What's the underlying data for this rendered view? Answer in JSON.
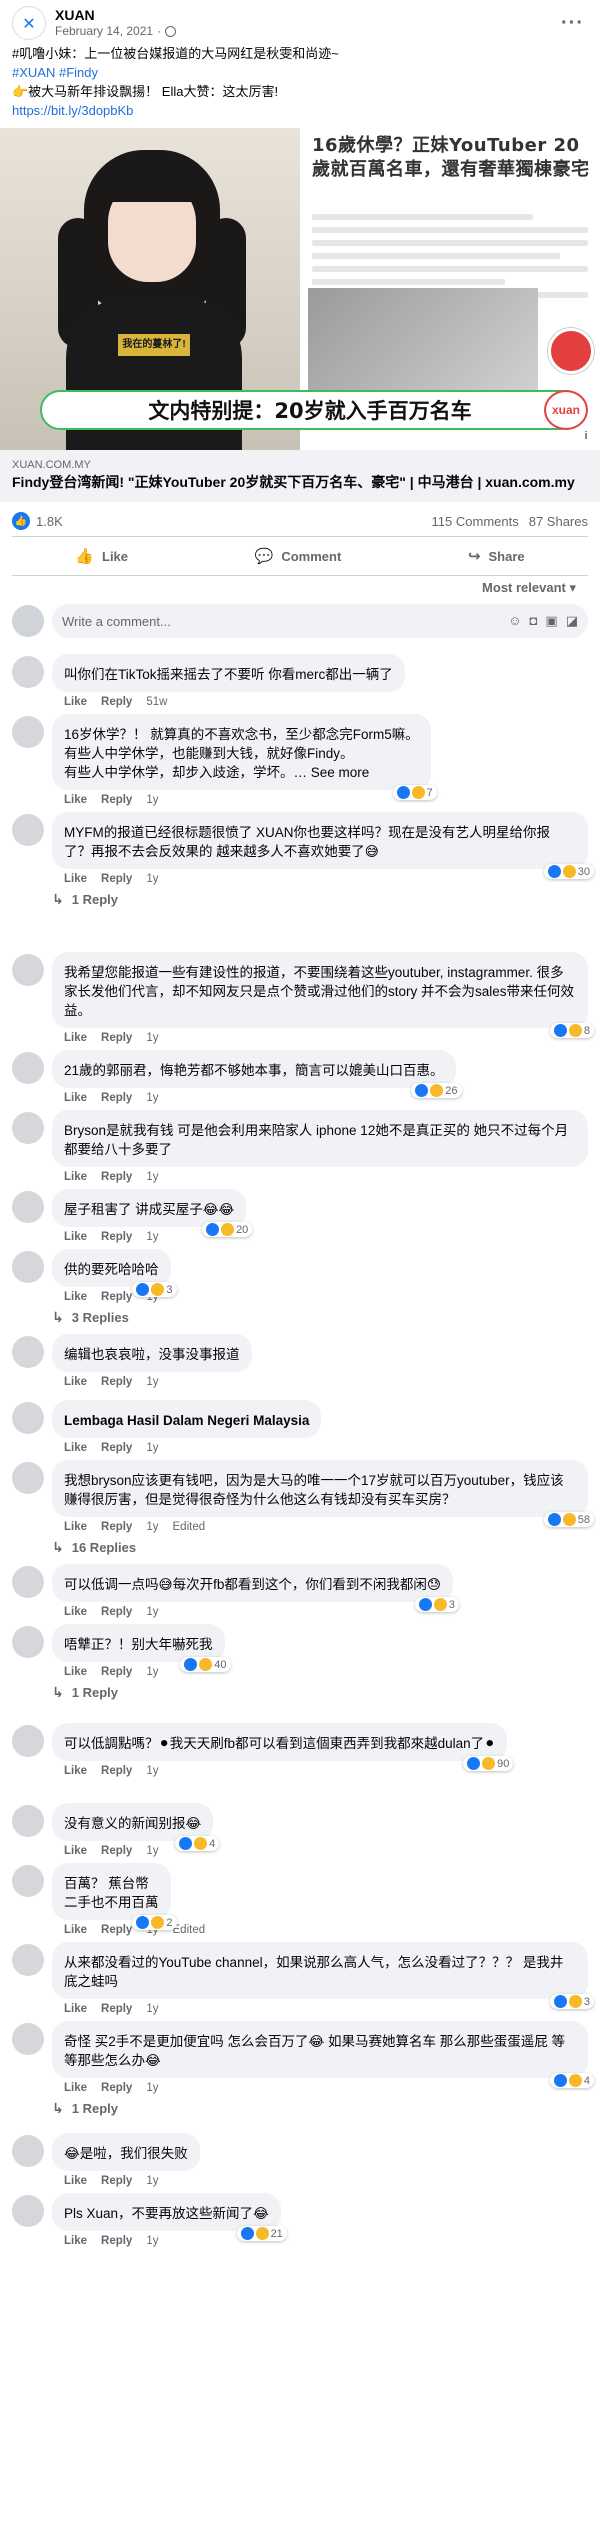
{
  "page_name": "XUAN",
  "post_date": "February 14, 2021",
  "post_lines": [
    "#叽噜小妹：上一位被台媒报道的大马网红是秋雯和尚迹~",
    "#XUAN #Findy",
    "👉被大马新年排设飘揚！ Ella大赞：这太厉害!",
    "https://bit.ly/3dopbKb"
  ],
  "image": {
    "headline": "16歲休學？正妹YouTuber 20歲就百萬名車，還有奢華獨棟豪宅",
    "shirt_text": "我在的蔓林了!",
    "banner": "文内特别提：20岁就入手百万名车",
    "badge": "xuan"
  },
  "link": {
    "domain": "XUAN.COM.MY",
    "title": "Findy登台湾新闻! \"正妹YouTuber 20岁就买下百万名车、豪宅\" | 中马港台 | xuan.com.my"
  },
  "stats": {
    "likes": "1.8K",
    "comments": "115 Comments",
    "shares": "87 Shares"
  },
  "actions": {
    "like": "Like",
    "comment": "Comment",
    "share": "Share"
  },
  "sort_label": "Most relevant ▾",
  "write_placeholder": "Write a comment...",
  "comment_labels": {
    "like": "Like",
    "reply": "Reply"
  },
  "comments": [
    {
      "text": "叫你们在TikTok摇来摇去了不要听 你看merc都出一辆了",
      "time": "51w",
      "react": "",
      "edited": ""
    },
    {
      "text": "16岁休学？！ 就算真的不喜欢念书，至少都念完Form5嘛。\n有些人中学休学，也能赚到大钱，就好像Findy。\n有些人中学休学，却步入歧途，学坏。… See more",
      "time": "1y",
      "react": "7",
      "edited": ""
    },
    {
      "text": "MYFM的报道已经很标题很愤了 XUAN你也要这样吗？现在是没有艺人明星给你报了？再报不去会反效果的 越来越多人不喜欢她要了😅",
      "time": "1y",
      "react": "30",
      "edited": ""
    },
    {
      "text": "我希望您能报道一些有建设性的报道，不要围绕着这些youtuber, instagrammer. 很多家长发他们代言，却不知网友只是点个赞或滑过他们的story 并不会为sales带来任何效益。",
      "time": "1y",
      "react": "8",
      "edited": ""
    },
    {
      "text": "21歲的郭丽君，悔艳芳都不够她本事，簡言可以媲美山口百惠。",
      "time": "1y",
      "react": "26",
      "edited": ""
    },
    {
      "text": "Bryson是就我有钱 可是他会利用来陪家人 iphone 12她不是真正买的 她只不过每个月都要给八十多要了",
      "time": "1y",
      "react": "",
      "edited": ""
    },
    {
      "text": "屋子租害了 讲成买屋子😂😂",
      "time": "1y",
      "react": "20",
      "edited": ""
    },
    {
      "text": "供的要死哈哈哈",
      "time": "1y",
      "react": "3",
      "edited": ""
    },
    {
      "text": "编辑也哀哀啦，没事没事报道",
      "time": "1y",
      "react": "",
      "edited": ""
    },
    {
      "text": "Lembaga Hasil Dalam Negeri Malaysia",
      "time": "1y",
      "react": "",
      "edited": "",
      "bold": true
    },
    {
      "text": "我想bryson应该更有钱吧，因为是大马的唯一一个17岁就可以百万youtuber，钱应该赚得很厉害，但是觉得很奇怪为什么他这么有钱却没有买车买房？",
      "time": "1y",
      "react": "58",
      "edited": "Edited"
    },
    {
      "text": "可以低调一点吗😅每次开fb都看到这个，你们看到不闲我都闲😓",
      "time": "1y",
      "react": "3",
      "edited": ""
    },
    {
      "text": "唔犨正？！别大年嚇死我",
      "time": "1y",
      "react": "40",
      "edited": ""
    },
    {
      "text": "可以低調點嗎？⚫我天天刷fb都可以看到這個東西弄到我都來越dulan了⚫",
      "time": "1y",
      "react": "90",
      "edited": ""
    },
    {
      "text": "没有意义的新闻别报😂",
      "time": "1y",
      "react": "4",
      "edited": ""
    },
    {
      "text": "百萬？ 蕉台幣\n二手也不用百萬",
      "time": "1y",
      "react": "2",
      "edited": "Edited"
    },
    {
      "text": "从来都没看过的YouTube channel，如果说那么高人气，怎么没看过了？？？ 是我井底之蛙吗",
      "time": "1y",
      "react": "3",
      "edited": ""
    },
    {
      "text": "奇怪 买2手不是更加便宜吗 怎么会百万了😂 如果马赛她算名车 那么那些蛋蛋遥屁 等等那些怎么办😂",
      "time": "1y",
      "react": "4",
      "edited": ""
    },
    {
      "text": "😂是啦，我们很失败",
      "time": "1y",
      "react": "",
      "edited": ""
    },
    {
      "text": "Pls Xuan，不要再放这些新闻了😂",
      "time": "1y",
      "react": "21",
      "edited": ""
    }
  ],
  "reply_links": {
    "c2": "1 Reply",
    "c7": "3 Replies",
    "c10": "16 Replies",
    "c12": "1 Reply",
    "c17": "1 Reply"
  },
  "colors": {
    "brand": "#1877f2",
    "link": "#216fdb",
    "bubble": "#f0f2f5",
    "banner_border": "#3dbd5a",
    "badge_red": "#e33f3f"
  }
}
